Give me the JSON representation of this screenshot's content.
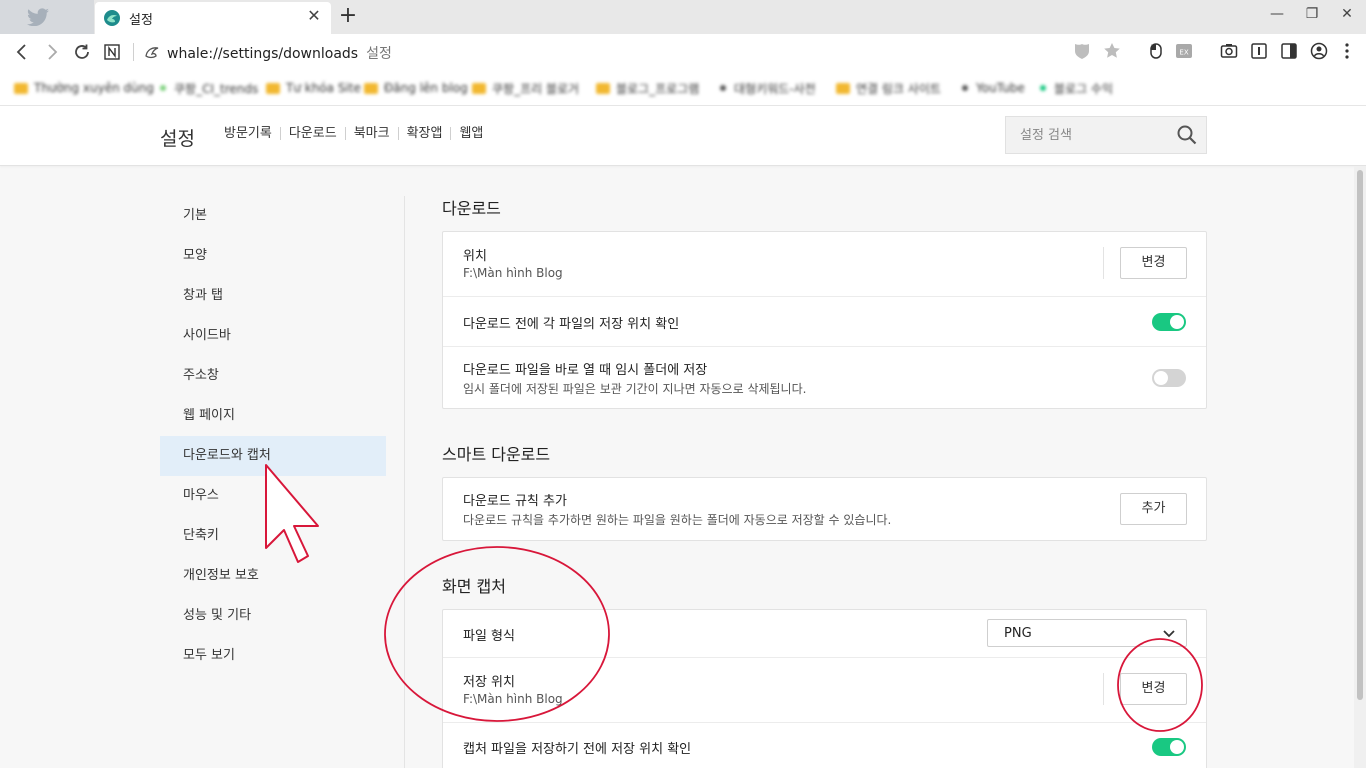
{
  "browser": {
    "tab": {
      "title": "설정",
      "close": "✕"
    },
    "new_tab": "+",
    "window": {
      "minimize": "—",
      "restore": "❐",
      "close": "✕"
    },
    "url": {
      "address": "whale://settings/downloads",
      "page_label": "설정"
    },
    "nav_icons": [
      "back-icon",
      "forward-icon",
      "reload-icon",
      "notion-icon"
    ],
    "right_icons": [
      "shield-icon",
      "star-icon",
      "mouse-icon",
      "ex-extension-icon",
      "camera-icon",
      "reader-icon",
      "sidebar-icon",
      "profile-icon",
      "menu-icon"
    ],
    "bookmarks": [
      {
        "type": "folder",
        "label": "Thường xuyên dùng"
      },
      {
        "type": "link",
        "label": "쿠팡_CI_trends",
        "color": "#7bd07b"
      },
      {
        "type": "folder",
        "label": "Tư khóa Site"
      },
      {
        "type": "folder",
        "label": "Đăng lên blog"
      },
      {
        "type": "folder",
        "label": "쿠팡_프리 블로거"
      },
      {
        "type": "folder",
        "label": "블로그_프로그램"
      },
      {
        "type": "link",
        "label": "대형키워드-사전",
        "color": "#555555"
      },
      {
        "type": "folder",
        "label": "연결 링크 사이트"
      },
      {
        "type": "link",
        "label": "YouTube",
        "color": "#555555"
      },
      {
        "type": "link",
        "label": "블로그 수익",
        "color": "#19c882"
      }
    ]
  },
  "settings_header": {
    "title": "설정",
    "nav": [
      "방문기록",
      "다운로드",
      "북마크",
      "확장앱",
      "웹앱"
    ],
    "search_placeholder": "설정 검색"
  },
  "sidebar": {
    "items": [
      {
        "label": "기본",
        "active": false
      },
      {
        "label": "모양",
        "active": false
      },
      {
        "label": "창과 탭",
        "active": false
      },
      {
        "label": "사이드바",
        "active": false
      },
      {
        "label": "주소창",
        "active": false
      },
      {
        "label": "웹 페이지",
        "active": false
      },
      {
        "label": "다운로드와 캡처",
        "active": true
      },
      {
        "label": "마우스",
        "active": false
      },
      {
        "label": "단축키",
        "active": false
      },
      {
        "label": "개인정보 보호",
        "active": false
      },
      {
        "label": "성능 및 기타",
        "active": false
      },
      {
        "label": "모두 보기",
        "active": false
      }
    ]
  },
  "download": {
    "title": "다운로드",
    "location": {
      "label": "위치",
      "path": "F:\\Màn hình Blog",
      "button": "변경"
    },
    "confirm_location": {
      "label": "다운로드 전에 각 파일의 저장 위치 확인",
      "enabled": true
    },
    "temp_folder": {
      "label": "다운로드 파일을 바로 열 때 임시 폴더에 저장",
      "description": "임시 폴더에 저장된 파일은 보관 기간이 지나면 자동으로 삭제됩니다.",
      "enabled": false
    }
  },
  "smart_download": {
    "title": "스마트 다운로드",
    "add_rule": {
      "label": "다운로드 규칙 추가",
      "description": "다운로드 규칙을 추가하면 원하는 파일을 원하는 폴더에 자동으로 저장할 수 있습니다.",
      "button": "추가"
    }
  },
  "screen_capture": {
    "title": "화면 캡처",
    "file_format": {
      "label": "파일 형식",
      "value": "PNG"
    },
    "save_location": {
      "label": "저장 위치",
      "path": "F:\\Màn hình Blog",
      "button": "변경"
    },
    "confirm_location": {
      "label": "캡처 파일을 저장하기 전에 저장 위치 확인",
      "enabled": true
    }
  },
  "colors": {
    "accent_green": "#19c882",
    "active_sidebar_bg": "#e2eef9",
    "annotation_red": "#d8173a"
  }
}
